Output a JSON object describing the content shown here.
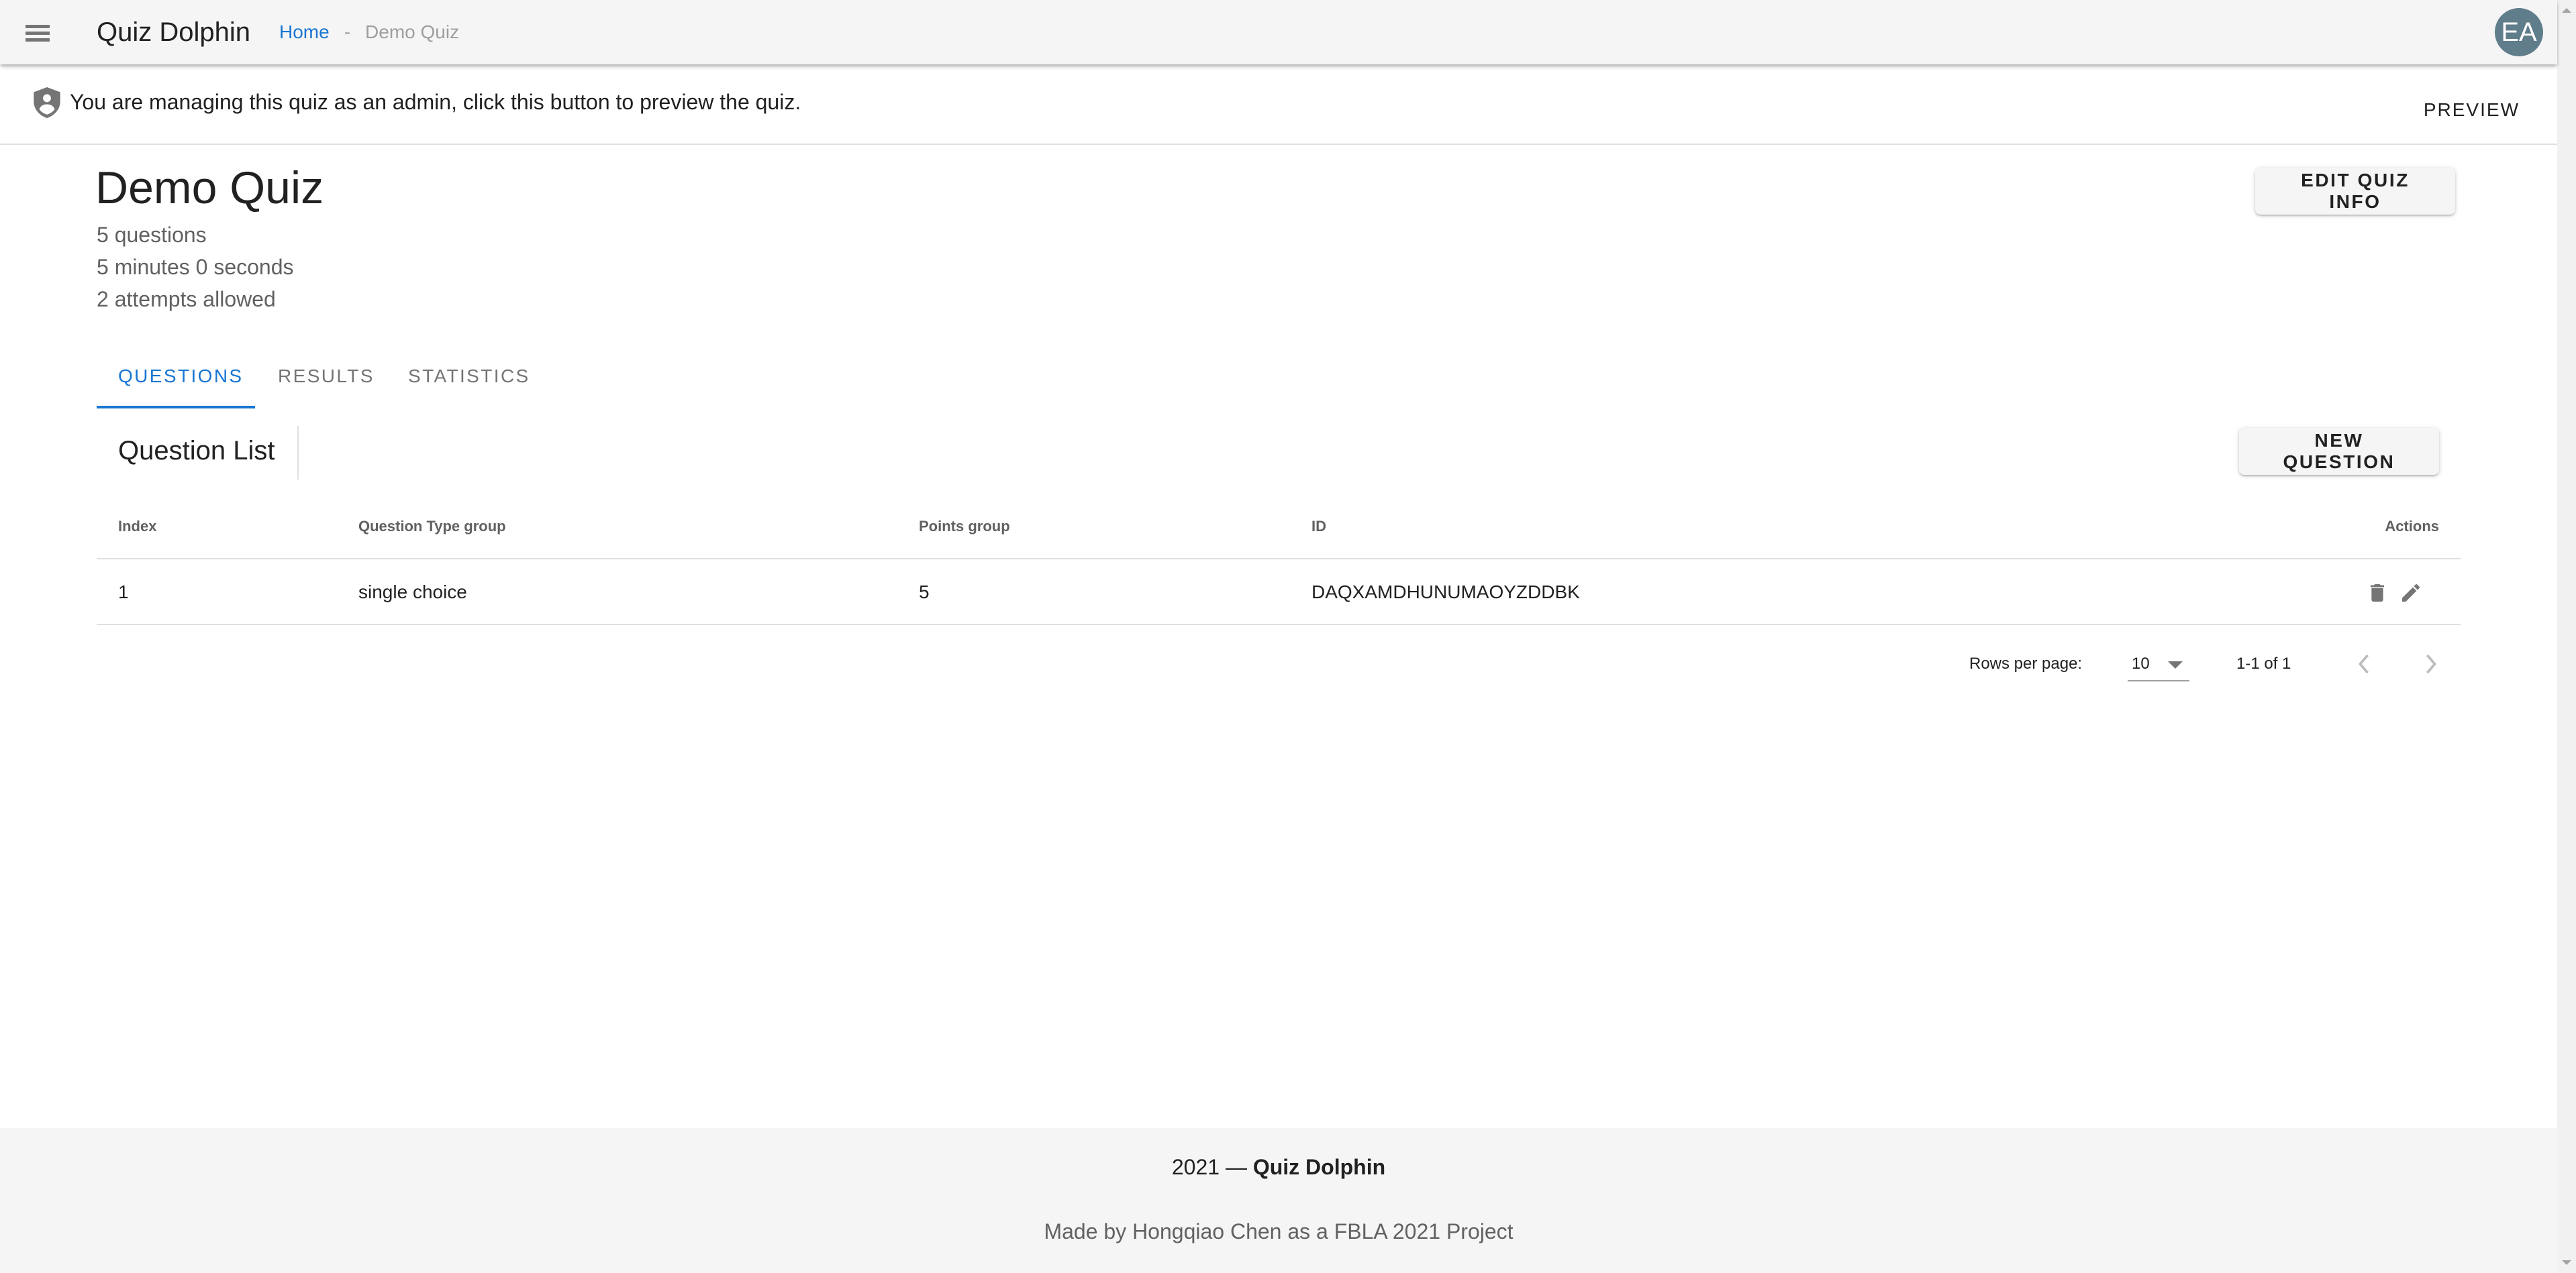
{
  "appbar": {
    "menu_icon": "hamburger-menu-icon",
    "title": "Quiz Dolphin",
    "breadcrumb": {
      "home": "Home",
      "separator": "-",
      "current": "Demo Quiz"
    },
    "avatar_initials": "EA",
    "avatar_color": "#607d8b"
  },
  "banner": {
    "icon": "admin-shield-icon",
    "message": "You are managing this quiz as an admin, click this button to preview the quiz.",
    "preview_label": "PREVIEW"
  },
  "quiz": {
    "title": "Demo Quiz",
    "questions_count": "5 questions",
    "duration": "5 minutes 0 seconds",
    "attempts": "2 attempts allowed",
    "edit_label": "EDIT QUIZ INFO"
  },
  "tabs": [
    {
      "label": "QUESTIONS",
      "active": true
    },
    {
      "label": "RESULTS",
      "active": false
    },
    {
      "label": "STATISTICS",
      "active": false
    }
  ],
  "question_list": {
    "title": "Question List",
    "new_question_label": "NEW QUESTION",
    "columns": [
      "Index",
      "Question Type group",
      "Points group",
      "ID",
      "Actions"
    ],
    "rows": [
      {
        "index": "1",
        "type": "single choice",
        "points": "5",
        "id": "DAQXAMDHUNUMAOYZDDBK",
        "actions": [
          "delete-icon",
          "edit-icon"
        ]
      }
    ],
    "pagination": {
      "rows_per_page_label": "Rows per page:",
      "rows_per_page": "10",
      "range": "1-1 of 1"
    }
  },
  "footer": {
    "year_prefix": "2021 —",
    "brand": "Quiz Dolphin",
    "credit": "Made by Hongqiao Chen as a FBLA 2021 Project"
  },
  "colors": {
    "accent": "#1976d2",
    "appbar_bg": "#f5f5f5",
    "footer_bg": "#f5f5f5"
  }
}
